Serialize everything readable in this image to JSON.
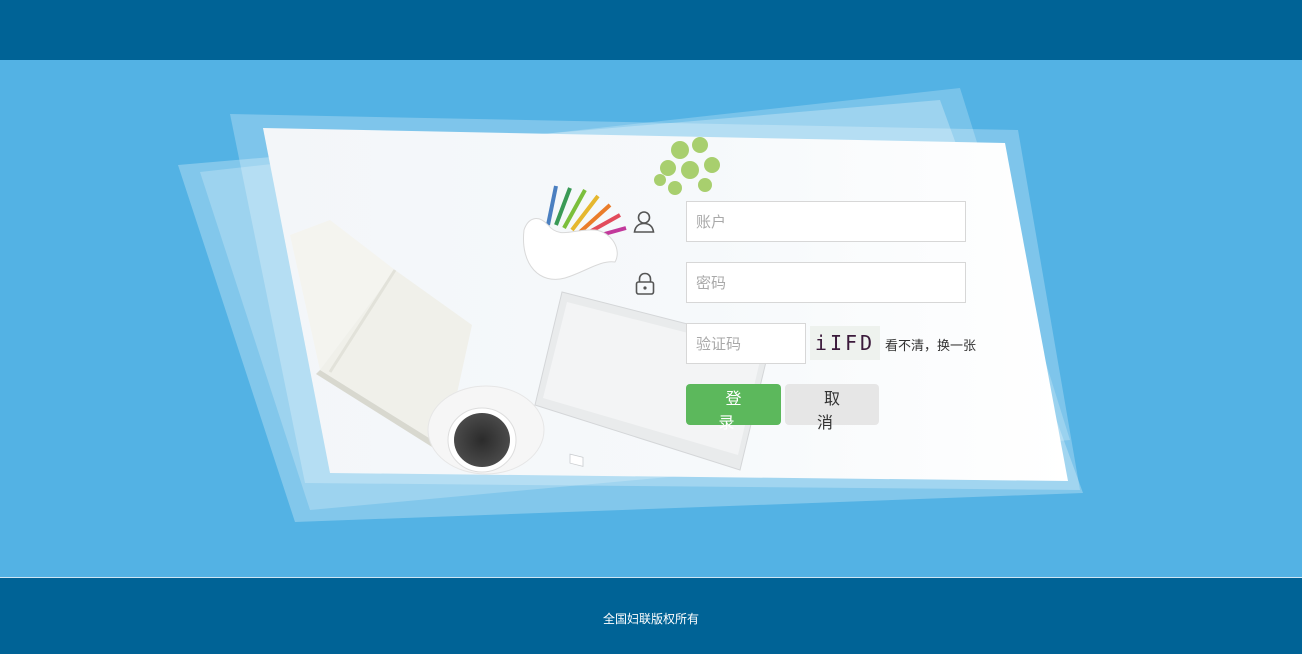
{
  "login": {
    "account_placeholder": "账户",
    "password_placeholder": "密码",
    "captcha_placeholder": "验证码",
    "captcha_text": "iIFD",
    "refresh_captcha_label": "看不清，换一张",
    "login_button": "登 录",
    "cancel_button": "取 消"
  },
  "footer": {
    "copyright": "全国妇联版权所有"
  },
  "icons": {
    "account": "user-icon",
    "password": "lock-icon"
  },
  "colors": {
    "header_bg": "#006396",
    "main_bg": "#53b2e4",
    "login_button_bg": "#5cb85c",
    "cancel_button_bg": "#e6e6e6"
  }
}
